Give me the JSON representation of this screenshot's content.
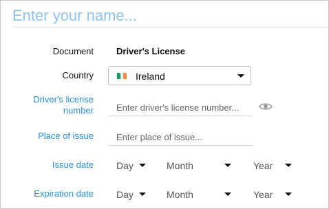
{
  "name_placeholder": "Enter your name...",
  "document": {
    "label": "Document",
    "value": "Driver's License"
  },
  "country": {
    "label": "Country",
    "value": "Ireland",
    "flag_colors": [
      "#169b62",
      "#ffffff",
      "#ff883e"
    ],
    "icons": {
      "flag": "ireland-flag-icon",
      "caret": "chevron-down-icon"
    }
  },
  "license": {
    "label_line1": "Driver's license",
    "label_line2": "number",
    "placeholder": "Enter driver's license number...",
    "icon": "eye-icon"
  },
  "place": {
    "label": "Place of issue",
    "placeholder": "Enter place of issue..."
  },
  "issue_date": {
    "label": "Issue date",
    "day": "Day",
    "month": "Month",
    "year": "Year"
  },
  "expiration_date": {
    "label": "Expiration date",
    "day": "Day",
    "month": "Month",
    "year": "Year"
  },
  "colors": {
    "accent_label": "#2a8fe0",
    "placeholder_name": "#8fc3ee"
  }
}
